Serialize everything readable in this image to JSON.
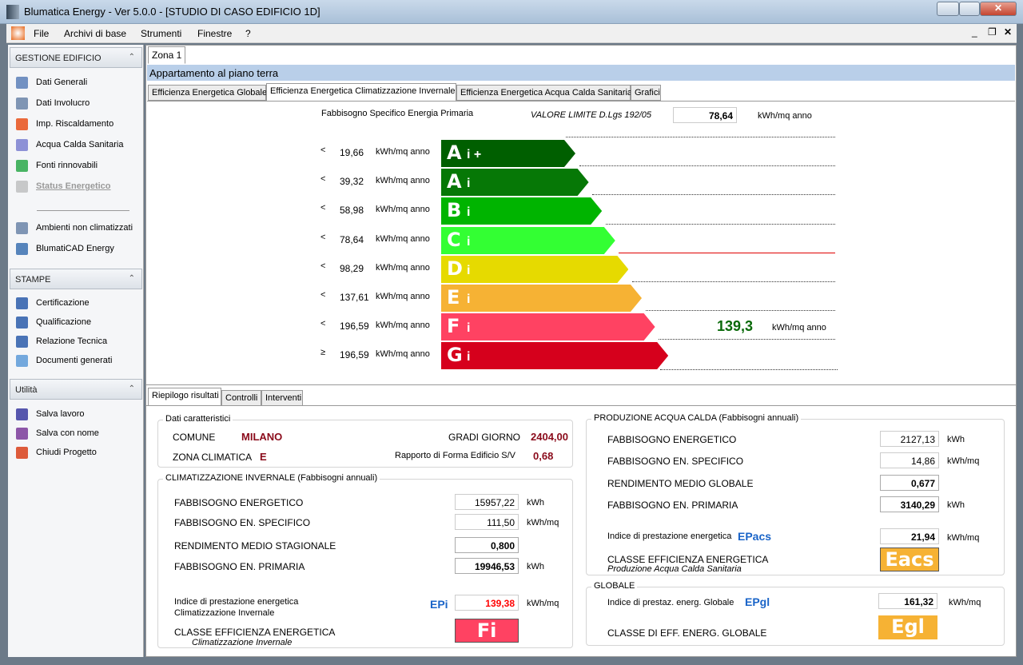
{
  "window": {
    "title": "Blumatica Energy - Ver 5.0.0 - [STUDIO DI CASO EDIFICIO 1D]"
  },
  "menu": [
    "File",
    "Archivi di base",
    "Strumenti",
    "Finestre",
    "?"
  ],
  "sidebar": {
    "sections": [
      {
        "title": "GESTIONE EDIFICIO",
        "items": [
          {
            "label": "Dati Generali",
            "icon": "document-icon"
          },
          {
            "label": "Dati Involucro",
            "icon": "table-icon"
          },
          {
            "label": "Imp. Riscaldamento",
            "icon": "flame-icon"
          },
          {
            "label": "Acqua Calda Sanitaria",
            "icon": "water-tank-icon"
          },
          {
            "label": "Fonti rinnovabili",
            "icon": "battery-icon"
          },
          {
            "label": "Status Energetico",
            "icon": "status-icon",
            "disabled": true
          },
          {
            "label": "Ambienti non climatizzati",
            "icon": "table-icon"
          },
          {
            "label": "BlumatiCAD Energy",
            "icon": "cad-icon"
          }
        ]
      },
      {
        "title": "STAMPE",
        "items": [
          {
            "label": "Certificazione",
            "icon": "word-doc-icon"
          },
          {
            "label": "Qualificazione",
            "icon": "word-doc-icon"
          },
          {
            "label": "Relazione Tecnica",
            "icon": "word-doc-icon"
          },
          {
            "label": "Documenti  generati",
            "icon": "folder-icon"
          }
        ]
      },
      {
        "title": "Utilità",
        "items": [
          {
            "label": "Salva lavoro",
            "icon": "save-icon"
          },
          {
            "label": "Salva con nome",
            "icon": "save-as-icon"
          },
          {
            "label": "Chiudi Progetto",
            "icon": "close-project-icon"
          }
        ]
      }
    ]
  },
  "main": {
    "zone_tab": "Zona 1",
    "zone_title": "Appartamento al piano terra",
    "tabs": [
      "Efficienza Energetica Globale",
      "Efficienza Energetica Climatizzazione Invernale",
      "Efficienza Energetica Acqua Calda Sanitaria",
      "Grafici"
    ],
    "selected_tab": 1,
    "scale": {
      "heading": "Fabbisogno Specifico Energia Primaria",
      "limit_label": "VALORE LIMITE D.Lgs 192/05",
      "limit_value": "78,64",
      "unit": "kWh/mq anno",
      "classes": [
        {
          "op": "<",
          "value": "19,66",
          "letter": "A",
          "sub": "i +",
          "color": "#005f00"
        },
        {
          "op": "<",
          "value": "39,32",
          "letter": "A",
          "sub": "i",
          "color": "#067806"
        },
        {
          "op": "<",
          "value": "58,98",
          "letter": "B",
          "sub": "i",
          "color": "#00b400"
        },
        {
          "op": "<",
          "value": "78,64",
          "letter": "C",
          "sub": "i",
          "color": "#33ff33"
        },
        {
          "op": "<",
          "value": "98,29",
          "letter": "D",
          "sub": "i",
          "color": "#e6da00"
        },
        {
          "op": "<",
          "value": "137,61",
          "letter": "E",
          "sub": "i",
          "color": "#f6b234"
        },
        {
          "op": "<",
          "value": "196,59",
          "letter": "F",
          "sub": "i",
          "color": "#ff4262"
        },
        {
          "op": "≥",
          "value": "196,59",
          "letter": "G",
          "sub": "i",
          "color": "#d6001c"
        }
      ],
      "current_class_index": 6,
      "current_value": "139,3",
      "limit_line_color": "#e00000"
    },
    "bottom_tabs": [
      "Riepilogo risultati",
      "Controlli",
      "Interventi"
    ],
    "dati": {
      "title": "Dati caratteristici",
      "comune_label": "COMUNE",
      "comune": "MILANO",
      "zona_label": "ZONA CLIMATICA",
      "zona": "E",
      "gg_label": "GRADI GIORNO",
      "gg": "2404,00",
      "sv_label": "Rapporto di Forma Edificio S/V",
      "sv": "0,68"
    },
    "inv": {
      "title": "CLIMATIZZAZIONE INVERNALE (Fabbisogni annuali)",
      "rows": [
        {
          "label": "FABBISOGNO ENERGETICO",
          "value": "15957,22",
          "unit": "kWh"
        },
        {
          "label": "FABBISOGNO EN. SPECIFICO",
          "value": "111,50",
          "unit": "kWh/mq"
        },
        {
          "label": "RENDIMENTO MEDIO STAGIONALE",
          "value": "0,800",
          "unit": ""
        },
        {
          "label": "FABBISOGNO EN. PRIMARIA",
          "value": "19946,53",
          "unit": "kWh"
        }
      ],
      "ind_label1": "Indice di prestazione energetica",
      "ind_label2": "Climatizzazione Invernale",
      "ep": "EPi",
      "ep_value": "139,38",
      "ep_unit": "kWh/mq",
      "class_label": "CLASSE EFFICIENZA ENERGETICA",
      "class_sub": "Climatizzazione Invernale",
      "class": "Fi",
      "class_color": "#ff4262"
    },
    "acs": {
      "title": "PRODUZIONE ACQUA CALDA (Fabbisogni annuali)",
      "rows": [
        {
          "label": "FABBISOGNO ENERGETICO",
          "value": "2127,13",
          "unit": "kWh"
        },
        {
          "label": "FABBISOGNO EN. SPECIFICO",
          "value": "14,86",
          "unit": "kWh/mq"
        },
        {
          "label": "RENDIMENTO MEDIO GLOBALE",
          "value": "0,677",
          "unit": ""
        },
        {
          "label": "FABBISOGNO EN. PRIMARIA",
          "value": "3140,29",
          "unit": "kWh"
        }
      ],
      "ind_label": "Indice di prestazione energetica",
      "ep": "EPacs",
      "ep_value": "21,94",
      "ep_unit": "kWh/mq",
      "class_label": "CLASSE EFFICIENZA ENERGETICA",
      "class_sub": "Produzione Acqua Calda Sanitaria",
      "class": "Eacs",
      "class_color": "#f6b234"
    },
    "glob": {
      "title": "GLOBALE",
      "ind_label": "Indice di prestaz. energ. Globale",
      "ep": "EPgl",
      "ep_value": "161,32",
      "ep_unit": "kWh/mq",
      "class_label": "CLASSE DI EFF. ENERG. GLOBALE",
      "class": "Egl",
      "class_color": "#f6b234"
    }
  }
}
